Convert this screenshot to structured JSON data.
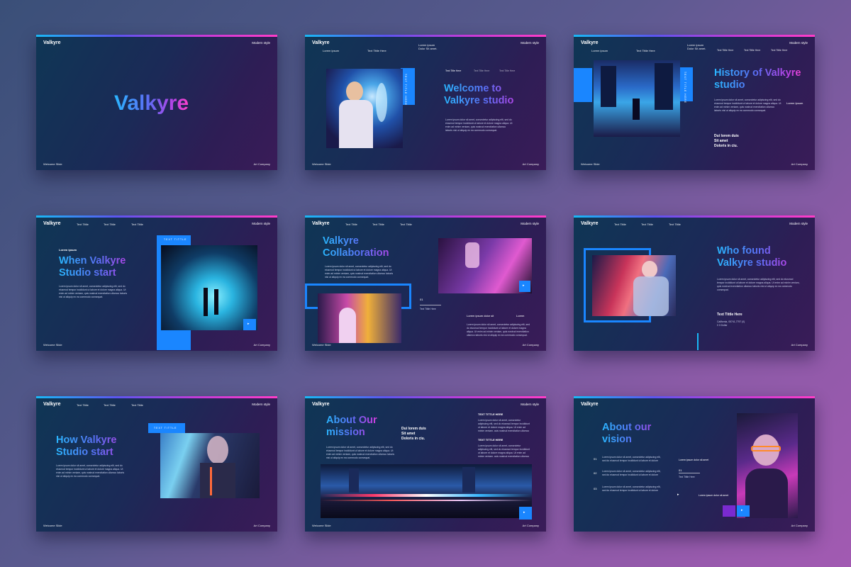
{
  "brand": "Valkyre",
  "common": {
    "modern_style": "Modern style",
    "welcome_slide": "Welcome Slide",
    "art_company": "Art Company",
    "text_title": "Text Tittle",
    "text_title_here": "Text Tittle Here",
    "lorem_ipsum": "Lorem ipsum",
    "lorem_dolor": "Lorem ipsum Dolor Sit amet.",
    "body": "Lorem ipsum dolor sit amet, consectetur adipiscing elit, sed do eiusmod tempor incididunt ut labore et dolore magna aliqua. Ut enim ad minim veniam, quis nostrud exercitation ullamco laboris nisi ut aliquip ex ea commodo consequat.",
    "dui": "Dui lorem duis Sit amet Doloris in ciu."
  },
  "slides": {
    "s1": {
      "title": "Valkyre"
    },
    "s2": {
      "title": "Welcome to Valkyre studio",
      "nav": [
        "Lorem ipsum",
        "Text Tittle Here"
      ],
      "tabs": [
        "Text Title Here",
        "Text Title Here",
        "Text Title Here"
      ],
      "vtag": "TEXT TITLE HERE"
    },
    "s3": {
      "title": "History of Valkyre studio",
      "side": "Lorem Ipsum",
      "dui1": "Dui lorem duis",
      "dui2": "Sit amet",
      "dui3": "Doloris in ciu.",
      "vtag": "TEXT TITLE HERE"
    },
    "s4": {
      "title": "When Valkyre Studio start",
      "eyebrow": "Lorem ipsum",
      "tag": "TEXT TITTLE"
    },
    "s5": {
      "title": "Valkyre Collaboration",
      "lorem": "Lorem ipsum dolor sit",
      "lorem2": "Lorem",
      "num": "01"
    },
    "s6": {
      "title": "Who found Valkyre studio",
      "label": "Text Tittle Here",
      "city": "California, 05741,7797 (0) 0 0 Dollar"
    },
    "s7": {
      "title": "How Valkyre Studio start",
      "tag": "TEXT TITTLE"
    },
    "s8": {
      "title": "About Our mission",
      "t1": "TEXT TITTLE HERE",
      "t2": "TEXT TITTLE HERE",
      "dui1": "Dui lorem duis",
      "dui2": "Sit amet",
      "dui3": "Doloris in ciu."
    },
    "s9": {
      "title": "About our vision",
      "nums": [
        "01",
        "02",
        "03"
      ],
      "num": "01",
      "label": "Text Tittle Here",
      "lorem": "Lorem ipsum dolor sit amet"
    }
  },
  "colors": {
    "accent": "#1a86ff",
    "pink": "#ff41c9",
    "cyan": "#2ab6ff"
  }
}
